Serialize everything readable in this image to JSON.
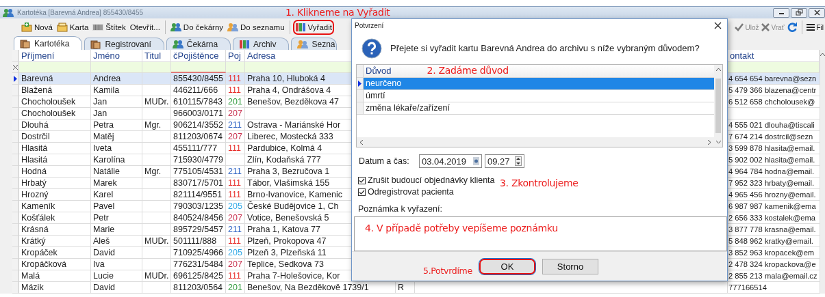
{
  "window": {
    "title": "Kartotéka [Barevná Andrea] 855430/8455"
  },
  "toolbar": [
    {
      "label": "Nová",
      "highlighted": false
    },
    {
      "label": "Karta",
      "highlighted": false
    },
    {
      "label": "Štítek",
      "highlighted": false
    },
    {
      "label": "Otevřít...",
      "highlighted": false
    },
    {
      "label": "Do čekárny",
      "highlighted": false
    },
    {
      "label": "Do seznamu",
      "highlighted": false
    },
    {
      "label": "Vyřadit",
      "highlighted": true
    }
  ],
  "toolbar_right": [
    {
      "label": "Ulož",
      "disabled": true
    },
    {
      "label": "Vrať",
      "disabled": true
    },
    {
      "disabled": false
    },
    {
      "label": "Fil",
      "disabled": false
    }
  ],
  "tabs": [
    {
      "label": "Kartotéka",
      "selected": true
    },
    {
      "label": "Registrovaní",
      "selected": false
    },
    {
      "label": "Čekárna",
      "selected": false
    },
    {
      "label": "Archiv",
      "selected": false
    },
    {
      "label": "Sezna",
      "selected": false
    }
  ],
  "table": {
    "headers": {
      "surname": "Příjmení",
      "first_name": "Jméno",
      "title": "Titul",
      "insurance_no": "čPojištěnce",
      "insurer": "Poj",
      "address": "Adresa",
      "contact": "ontakt"
    },
    "rows": [
      {
        "surname": "Barevná",
        "first_name": "Andrea",
        "insurance_no": "855430/8455",
        "insurer": "111",
        "color": "#e8322f",
        "address": "Praha 10, Hluboká 4",
        "contact": "4 654 654 barevna@sezn",
        "selected": true
      },
      {
        "surname": "Blažená",
        "first_name": "Kamila",
        "insurance_no": "446211/666",
        "insurer": "111",
        "color": "#e8322f",
        "address": "Praha 4, Ondrášova 4",
        "contact": "5 479 366 blazena@centr",
        "selected": false
      },
      {
        "surname": "Chocholoušek",
        "first_name": "Jan",
        "title": "MUDr.",
        "insurance_no": "610115/7843",
        "insurer": "201",
        "color": "#2f9a3c",
        "address": "Benešov, Bezděkova 47",
        "contact": "6 512 658 chcholousek@",
        "selected": false
      },
      {
        "surname": "Chocholoušek",
        "first_name": "Jan",
        "insurance_no": "966003/0171",
        "insurer": "207",
        "color": "#c8304e",
        "selected": false
      },
      {
        "surname": "Dlouhá",
        "first_name": "Petra",
        "title": "Mgr.",
        "insurance_no": "906214/3552",
        "insurer": "211",
        "color": "#2e63c4",
        "address": "Ostrava - Mariánské Hor",
        "contact": "4 555 021 dlouha@tiscali",
        "selected": false
      },
      {
        "surname": "Dostrčil",
        "first_name": "Matěj",
        "insurance_no": "811203/0674",
        "insurer": "207",
        "color": "#c8304e",
        "address": "Liberec, Mostecká 333",
        "contact": "7 674 214 dostrcil@sezn",
        "selected": false
      },
      {
        "surname": "Hlasitá",
        "first_name": "Iveta",
        "insurance_no": "455111/777",
        "insurer": "111",
        "color": "#e8322f",
        "address": "Pardubice, Kolmá 4",
        "contact": "3 599 878 hlasita@email.",
        "selected": false
      },
      {
        "surname": "Hlasitá",
        "first_name": "Karolína",
        "insurance_no": "715930/4779",
        "address": "Zlín, Kodaňská 777",
        "contact": "5 902 002 hlasita@email.",
        "selected": false
      },
      {
        "surname": "Hodná",
        "first_name": "Natálie",
        "title": "Mgr.",
        "insurance_no": "775105/4531",
        "insurer": "211",
        "color": "#2e63c4",
        "address": "Praha 3, Bezručova 1",
        "contact": "4 964 784 hodna@email.",
        "selected": false
      },
      {
        "surname": "Hrbatý",
        "first_name": "Marek",
        "insurance_no": "830717/5701",
        "insurer": "111",
        "color": "#e8322f",
        "address": "Tábor, Vlašimská 155",
        "contact": "7 952 323 hrbaty@email.",
        "selected": false
      },
      {
        "surname": "Hrozný",
        "first_name": "Karel",
        "insurance_no": "821114/9551",
        "insurer": "111",
        "color": "#e8322f",
        "address": "Brno-Ivanovice, Kamenic",
        "contact": "4 965 456 hrozny@email.",
        "selected": false
      },
      {
        "surname": "Kameník",
        "first_name": "Pavel",
        "insurance_no": "790303/1235",
        "insurer": "205",
        "color": "#2fa8e6",
        "address": "České Budějovice 1, Ch",
        "contact": "6 987 987 kamenik@ema",
        "selected": false
      },
      {
        "surname": "Košťálek",
        "first_name": "Petr",
        "insurance_no": "840524/8456",
        "insurer": "207",
        "color": "#c8304e",
        "address": "Votice, Benešovská 5",
        "contact": "2 656 333 kostalek@ema",
        "selected": false
      },
      {
        "surname": "Krásná",
        "first_name": "Marie",
        "insurance_no": "895729/5457",
        "insurer": "211",
        "color": "#2e63c4",
        "address": "Praha 1, Katova 77",
        "contact": "3 877 778 krasna@email.",
        "selected": false
      },
      {
        "surname": "Krátký",
        "first_name": "Aleš",
        "title": "MUDr.",
        "insurance_no": "501111/888",
        "insurer": "111",
        "color": "#e8322f",
        "address": "Plzeň, Prokopova 47",
        "contact": "5 848 962 kratky@email.",
        "selected": false
      },
      {
        "surname": "Kropáček",
        "first_name": "David",
        "insurance_no": "710925/4966",
        "insurer": "205",
        "color": "#2fa8e6",
        "address": "Plzeň 3, Plzeňská 11",
        "contact": "3 852 963 kropacek@em",
        "selected": false
      },
      {
        "surname": "Kropáčková",
        "first_name": "Iva",
        "insurance_no": "776231/5484",
        "insurer": "207",
        "color": "#c8304e",
        "address": "Teplice, Sedkova 73",
        "contact": "2 478 324 kropackova@e",
        "selected": false
      },
      {
        "surname": "Malá",
        "first_name": "Lucie",
        "title": "MUDr.",
        "insurance_no": "696125/8425",
        "insurer": "111",
        "color": "#e8322f",
        "address": "Praha 7-Holešovice, Kor",
        "contact": "2 855 213 mala@email.cz",
        "selected": false
      },
      {
        "surname": "Mázik",
        "first_name": "David",
        "insurance_no": "811203/0564",
        "insurer": "201",
        "color": "#2f9a3c",
        "address": "Benešov, Na Bezděkově 1739/1",
        "column_7": "R",
        "contact": "777166514",
        "selected": false
      }
    ]
  },
  "dialog": {
    "title": "Potvrzení",
    "message": "Přejete si vyřadit kartu Barevná Andrea do archivu s níže vybraným důvodem?",
    "reasons": {
      "header": "Důvod",
      "rows": [
        {
          "label": "neurčeno",
          "selected": true
        },
        {
          "label": "úmrtí",
          "selected": false
        },
        {
          "label": "změna lékaře/zařízení",
          "selected": false
        }
      ]
    },
    "date_label": "Datum a čas:",
    "date": "03.04.2019",
    "time": "09.27",
    "options": [
      {
        "label": "Zrušit budoucí objednávky klienta",
        "checked": true
      },
      {
        "label": "Odregistrovat pacienta",
        "checked": true
      }
    ],
    "note_label": "Poznámka k vyřazení:",
    "buttons": [
      {
        "label": "OK",
        "highlighted": true
      },
      {
        "label": "Storno",
        "highlighted": false
      }
    ]
  },
  "annotations": [
    "1. Klikneme na Vyřadit",
    "2. Zadáme důvod",
    "3. Zkontrolujeme",
    "4. V případě potřeby vepíšeme poznámku",
    "5.Potvrdíme"
  ]
}
